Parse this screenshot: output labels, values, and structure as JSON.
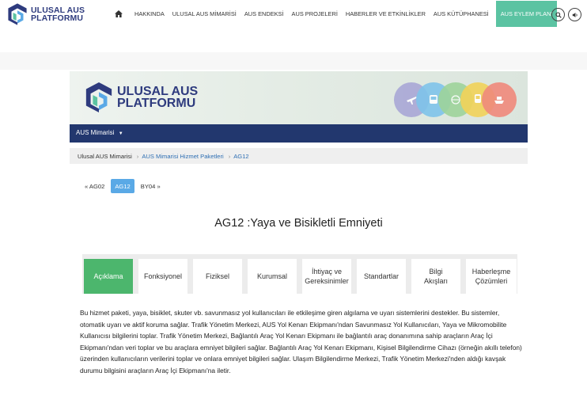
{
  "header": {
    "logo_line1": "ULUSAL AUS",
    "logo_line2": "PLATFORMU",
    "nav_items": [
      {
        "label": "HAKKINDA"
      },
      {
        "label": "ULUSAL AUS MİMARİSİ"
      },
      {
        "label": "AUS ENDEKSİ"
      },
      {
        "label": "AUS PROJELERİ"
      },
      {
        "label": "HABERLER VE ETKİNLİKLER"
      },
      {
        "label": "AUS KÜTÜPHANESİ"
      },
      {
        "label": "AUS EYLEM PLANI"
      }
    ],
    "accent_color": "#5bc3a2",
    "icons": [
      "home-icon",
      "search-icon",
      "volume-icon"
    ]
  },
  "banner": {
    "logo_line1": "ULUSAL AUS",
    "logo_line2": "PLATFORMU",
    "circles": [
      {
        "color": "#a9a7d6",
        "icon": "plane-icon"
      },
      {
        "color": "#7fc4ea",
        "icon": "bus-icon"
      },
      {
        "color": "#9ed49b",
        "icon": "globe-icon"
      },
      {
        "color": "#f2d35a",
        "icon": "train-icon"
      },
      {
        "color": "#f08a7c",
        "icon": "ship-icon"
      }
    ]
  },
  "subnav": {
    "label": "AUS Mimarisi"
  },
  "breadcrumb": {
    "items": [
      "Ulusal AUS Mimarisi",
      "AUS Mimarisi Hizmet Paketleri",
      "AG12"
    ]
  },
  "pager": {
    "prev": "« AG02",
    "current": "AG12",
    "next": "BY04 »"
  },
  "page_title": "AG12 :Yaya ve Bisikletli Emniyeti",
  "tabs": [
    {
      "line1": "Açıklama",
      "line2": ""
    },
    {
      "line1": "Fonksiyonel",
      "line2": ""
    },
    {
      "line1": "Fiziksel",
      "line2": ""
    },
    {
      "line1": "Kurumsal",
      "line2": ""
    },
    {
      "line1": "İhtiyaç ve",
      "line2": "Gereksinimler"
    },
    {
      "line1": "Standartlar",
      "line2": ""
    },
    {
      "line1": "Bilgi",
      "line2": "Akışları"
    },
    {
      "line1": "Haberleşme",
      "line2": "Çözümleri"
    }
  ],
  "active_tab_color": "#4cb66d",
  "description": "Bu hizmet paketi, yaya, bisiklet, skuter vb. savunmasız yol kullanıcıları ile etkileşime giren algılama ve uyarı sistemlerini destekler. Bu sistemler, otomatik uyarı ve aktif koruma sağlar. Trafik Yönetim Merkezi, AUS Yol Kenarı Ekipmanı'ndan Savunmasız Yol Kullanıcıları, Yaya ve Mikromobilite Kullanıcısı bilgilerini toplar. Trafik Yönetim Merkezi, Bağlantılı Araç Yol Kenarı Ekipmanı ile bağlantılı araç donanımına sahip araçların Araç İçi Ekipmanı'ndan veri toplar ve bu araçlara emniyet bilgileri sağlar. Bağlantılı Araç Yol Kenarı Ekipmanı, Kişisel Bilgilendirme Cihazı (örneğin akıllı telefon) üzerinden kullanıcıların verilerini toplar ve onlara emniyet bilgileri sağlar. Ulaşım Bilgilendirme Merkezi, Trafik Yönetim Merkezi'nden aldığı kavşak durumu bilgisini araçların Araç İçi Ekipmanı'na iletir."
}
